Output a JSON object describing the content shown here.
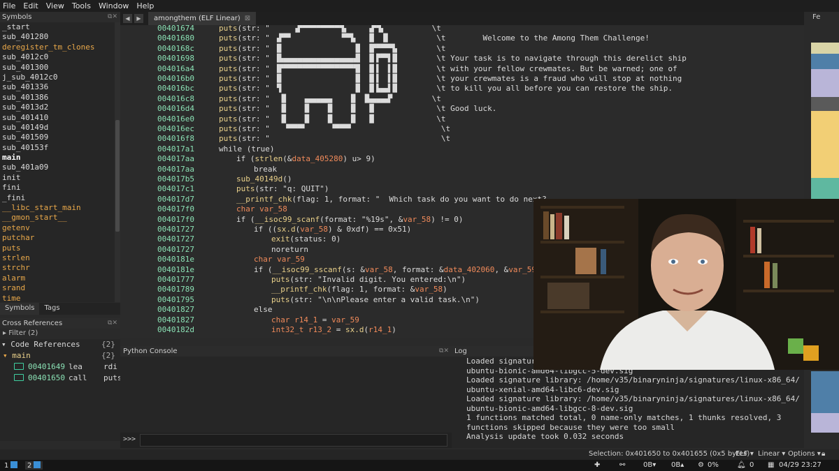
{
  "menu": [
    "File",
    "Edit",
    "View",
    "Tools",
    "Window",
    "Help"
  ],
  "symbols": {
    "title": "Symbols",
    "items": [
      {
        "name": "_start",
        "color": "#dcdcdc"
      },
      {
        "name": "sub_401280",
        "color": "#dcdcdc"
      },
      {
        "name": "deregister_tm_clones",
        "color": "#e9a84a"
      },
      {
        "name": "sub_4012c0",
        "color": "#dcdcdc"
      },
      {
        "name": "sub_401300",
        "color": "#dcdcdc"
      },
      {
        "name": "j_sub_4012c0",
        "color": "#dcdcdc"
      },
      {
        "name": "sub_401336",
        "color": "#dcdcdc"
      },
      {
        "name": "sub_401386",
        "color": "#dcdcdc"
      },
      {
        "name": "sub_4013d2",
        "color": "#dcdcdc"
      },
      {
        "name": "sub_401410",
        "color": "#dcdcdc"
      },
      {
        "name": "sub_40149d",
        "color": "#dcdcdc"
      },
      {
        "name": "sub_401509",
        "color": "#dcdcdc"
      },
      {
        "name": "sub_40153f",
        "color": "#dcdcdc"
      },
      {
        "name": "main",
        "color": "#ffffff",
        "bold": true
      },
      {
        "name": "sub_401a09",
        "color": "#dcdcdc"
      },
      {
        "name": "init",
        "color": "#dcdcdc"
      },
      {
        "name": "fini",
        "color": "#dcdcdc"
      },
      {
        "name": "_fini",
        "color": "#dcdcdc"
      },
      {
        "name": "__libc_start_main",
        "color": "#e9a84a"
      },
      {
        "name": "__gmon_start__",
        "color": "#e9a84a"
      },
      {
        "name": "getenv",
        "color": "#e9a84a"
      },
      {
        "name": "putchar",
        "color": "#e9a84a"
      },
      {
        "name": "puts",
        "color": "#e9a84a"
      },
      {
        "name": "strlen",
        "color": "#e9a84a"
      },
      {
        "name": "strchr",
        "color": "#e9a84a"
      },
      {
        "name": "alarm",
        "color": "#e9a84a"
      },
      {
        "name": "srand",
        "color": "#e9a84a"
      },
      {
        "name": "time",
        "color": "#e9a84a"
      }
    ],
    "tabs": [
      "Symbols",
      "Tags"
    ]
  },
  "xrefs": {
    "title": "Cross References",
    "filter": "Filter (2)",
    "code_refs_label": "Code References",
    "code_refs_count": "{2}",
    "group": "main",
    "group_count": "{2}",
    "refs": [
      {
        "addr": "00401649",
        "op": "lea",
        "arg": "rdi"
      },
      {
        "addr": "00401650",
        "op": "call",
        "arg": "puts"
      }
    ]
  },
  "editor": {
    "tab_label": "amongthem (ELF Linear)",
    "lines": [
      {
        "addr": "00401674",
        "indent": 0,
        "html": "<span class='fn'>puts</span>(str: \"     ▗▛▀▀▀▀▀▀▀▀▜▖    ▗▛▜▖          \\t       "
      },
      {
        "addr": "00401680",
        "indent": 0,
        "html": "<span class='fn'>puts</span>(str: \" ▗▛▀▘          ▝▀▜▖  ▐▌ ▐▌          \\t        Welcome to the Among Them Challenge!"
      },
      {
        "addr": "0040168c",
        "indent": 0,
        "html": "<span class='fn'>puts</span>(str: \" ▐▌               ▐▌ ▐▛▀▀▀▜▖        \\t"
      },
      {
        "addr": "00401698",
        "indent": 0,
        "html": "<span class='fn'>puts</span>(str: \" ▐▙▄▄▄▄▄▄▄▄▄▄▄▄▄▄▄▟▌ ▐▌▛▀▜▐▌        \\t Your task is to navigate through this derelict ship"
      },
      {
        "addr": "004016a4",
        "indent": 0,
        "html": "<span class='fn'>puts</span>(str: \" ▐▛▀▀▀▀▀▀▀▀▀▀▀▀▀▀▀▜▌ ▐▌▌ ▐▐▌        \\t with your fellow crewmates. But be warned; one of"
      },
      {
        "addr": "004016b0",
        "indent": 0,
        "html": "<span class='fn'>puts</span>(str: \" ▐▌               ▐▌ ▐▌▌ ▐▐▌        \\t your crewmates is a fraud who will stop at nothing"
      },
      {
        "addr": "004016bc",
        "indent": 0,
        "html": "<span class='fn'>puts</span>(str: \" ▝▌               ▐▌ ▐▌▙▄▟▐▌        \\t to kill you all before you can restore the ship."
      },
      {
        "addr": "004016c8",
        "indent": 0,
        "html": "<span class='fn'>puts</span>(str: \"  ▐▌   ▗▄▄▄▄▄▖   ▐▌ ▐▙▄▄▄▟▘        \\t"
      },
      {
        "addr": "004016d4",
        "indent": 0,
        "html": "<span class='fn'>puts</span>(str: \"  ▐▌   ▐▌   ▐▌   ▐▌  ▐▌             \\t Good luck."
      },
      {
        "addr": "004016e0",
        "indent": 0,
        "html": "<span class='fn'>puts</span>(str: \"  ▐▌   ▐▌   ▐▌   ▐▌  ▐▌             \\t"
      },
      {
        "addr": "004016ec",
        "indent": 0,
        "html": "<span class='fn'>puts</span>(str: \"   ▝▀▀▀▘     ▝▀▀▀▘                   \\t"
      },
      {
        "addr": "004016f8",
        "indent": 0,
        "html": "<span class='fn'>puts</span>(str: \"                                     \\t"
      },
      {
        "addr": "004017a1",
        "indent": 0,
        "html": "while (true)"
      },
      {
        "addr": "004017aa",
        "indent": 1,
        "html": "if (<span class='fn'>strlen</span>(&amp;<span class='var'>data_405280</span>) u&gt; 9)"
      },
      {
        "addr": "004017aa",
        "indent": 2,
        "html": "break"
      },
      {
        "addr": "004017b5",
        "indent": 1,
        "html": "<span class='fn'>sub_40149d</span>()"
      },
      {
        "addr": "004017c1",
        "indent": 1,
        "html": "<span class='fn'>puts</span>(str: \"q: QUIT\")"
      },
      {
        "addr": "004017d7",
        "indent": 1,
        "html": "<span class='fn'>__printf_chk</span>(flag: 1, format: \"  Which task do you want to do next?"
      },
      {
        "addr": "004017f0",
        "indent": 1,
        "html": "<span class='var'>char var_58</span>"
      },
      {
        "addr": "004017f0",
        "indent": 1,
        "html": "if (<span class='fn'>__isoc99_scanf</span>(format: \"%19s\", &amp;<span class='var'>var_58</span>) != 0)"
      },
      {
        "addr": "00401727",
        "indent": 2,
        "html": "if ((<span class='fn'>sx.d</span>(<span class='var'>var_58</span>) &amp; 0xdf) == 0x51)"
      },
      {
        "addr": "00401727",
        "indent": 3,
        "html": "<span class='fn'>exit</span>(status: 0)"
      },
      {
        "addr": "00401727",
        "indent": 3,
        "html": "noreturn"
      },
      {
        "addr": "0040181e",
        "indent": 2,
        "html": "<span class='var'>char var_59</span>"
      },
      {
        "addr": "0040181e",
        "indent": 2,
        "html": "if (<span class='fn'>__isoc99_sscanf</span>(s: &amp;<span class='var'>var_58</span>, format: &amp;<span class='var'>data_402060</span>, &amp;<span class='var'>var_59</span>) !"
      },
      {
        "addr": "00401777",
        "indent": 3,
        "html": "<span class='fn'>puts</span>(str: \"Invalid digit. You entered:\\n\")"
      },
      {
        "addr": "00401789",
        "indent": 3,
        "html": "<span class='fn'>__printf_chk</span>(flag: 1, format: &amp;<span class='var'>var_58</span>)"
      },
      {
        "addr": "00401795",
        "indent": 3,
        "html": "<span class='fn'>puts</span>(str: \"\\n\\nPlease enter a valid task.\\n\")"
      },
      {
        "addr": "00401827",
        "indent": 2,
        "html": "else"
      },
      {
        "addr": "00401827",
        "indent": 3,
        "html": "<span class='var'>char r14_1</span> = <span class='var'>var_59</span>"
      },
      {
        "addr": "0040182d",
        "indent": 3,
        "html": "<span class='var'>int32_t r13_2</span> = <span class='fn'>sx.d</span>(<span class='var'>r14_1</span>)"
      }
    ]
  },
  "minimap": {
    "title": "Fe"
  },
  "python": {
    "title": "Python Console",
    "prompt": ">>>",
    "input": ""
  },
  "log": {
    "title": "Log",
    "lines": [
      "Loaded signatur",
      "ubuntu-bionic-amd64-libgcc-5-dev.sig",
      "Loaded signature library: /home/v35/binaryninja/signatures/linux-x86_64/",
      "ubuntu-xenial-amd64-libc6-dev.sig",
      "Loaded signature library: /home/v35/binaryninja/signatures/linux-x86_64/",
      "ubuntu-bionic-amd64-libgcc-8-dev.sig",
      "1 functions matched total, 0 name-only matches, 1 thunks resolved, 3",
      "functions skipped because they were too small",
      "Analysis update took 0.032 seconds"
    ]
  },
  "status": {
    "selection": "Selection: 0x401650 to 0x401655 (0x5 bytes)",
    "elf": "ELF ▾",
    "linear": "Linear ▾",
    "options": "Options ▾"
  },
  "taskbar": {
    "ws1": "1",
    "ws2": "2",
    "net_down": "0B▾",
    "net_up": "0B▴",
    "cpu": "0%",
    "notif": "0",
    "datetime": "04/29 23:27"
  },
  "colors": {
    "address": "#8ae0b4",
    "function": "#e9d08a",
    "variable": "#f08a5a",
    "import": "#e9a84a",
    "xref_icon": "#3fcfa0",
    "accent": "#3a8fd6"
  }
}
